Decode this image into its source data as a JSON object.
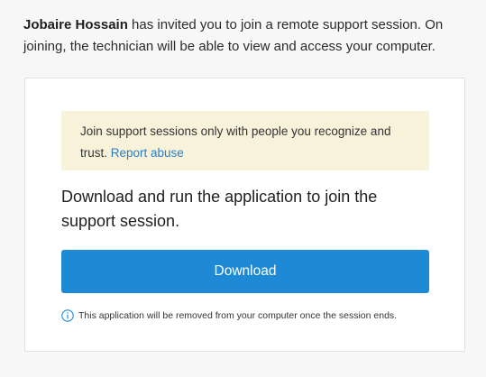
{
  "intro": {
    "inviter": "Jobaire Hossain",
    "message": " has invited you to join a remote support session. On joining, the technician will be able to view and access your computer."
  },
  "notice": {
    "text": "Join support sessions only with people you recognize and trust. ",
    "report_link": "Report abuse"
  },
  "headline": "Download and run the application to join the support session.",
  "download_button": "Download",
  "info": {
    "icon": "info-icon",
    "text": "This application will be removed from your computer once the session ends."
  },
  "colors": {
    "accent": "#1e8ad6",
    "link": "#2a7fc4",
    "notice_bg": "#f8f2db"
  }
}
